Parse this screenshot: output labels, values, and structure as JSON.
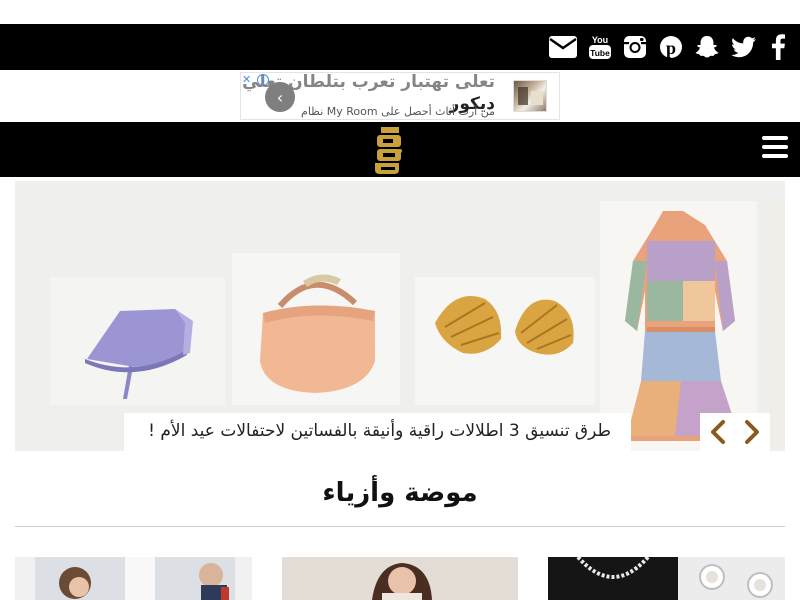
{
  "social": {
    "icons": [
      "email-icon",
      "youtube-icon",
      "instagram-icon",
      "pinterest-icon",
      "snapchat-icon",
      "twitter-icon",
      "facebook-icon"
    ],
    "youtube_text": "You Tube"
  },
  "ad": {
    "title_line1": "تعلى تهتبار تعرب بتلطان تعلي",
    "title_line2": "ديكور",
    "subtitle": "من آرت أثاث أحصل على My Room نظام",
    "close_label": "✕",
    "info_label": "i",
    "back_label": "‹"
  },
  "nav": {
    "logo": "site-logo",
    "menu_icon": "hamburger-menu-icon"
  },
  "slider": {
    "caption": "طرق تنسيق 3 اطلالات راقية وأنيقة بالفساتين لاحتفالات عيد الأم !"
  },
  "section": {
    "title": "موضة وأزياء"
  },
  "colors": {
    "bar": "#000000",
    "logo_gold": "#c9a13a",
    "slider_bg": "#efefed",
    "arrow": "#8a5a1e"
  }
}
